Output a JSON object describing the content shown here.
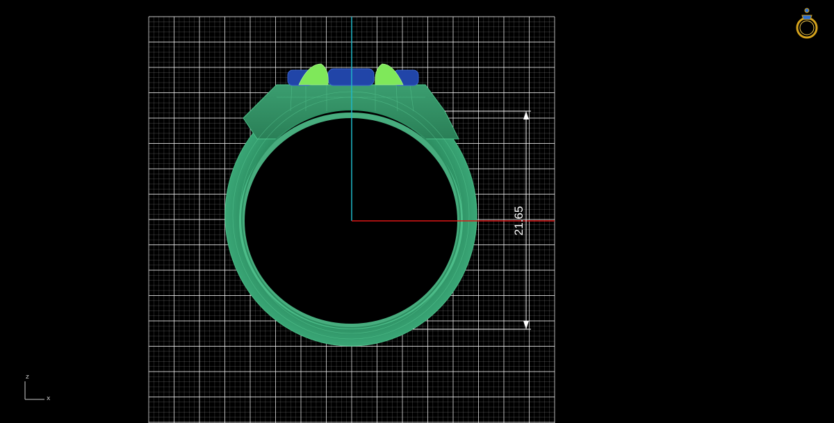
{
  "viewport": {
    "background": "#000000",
    "grid_color": "#ffffff",
    "view": "front"
  },
  "axes": {
    "vertical_axis_color": "#1fb7c8",
    "horizontal_axis_color": "#e01616"
  },
  "ring": {
    "band_color": "#2e8f62",
    "band_edge_color": "#4cc28a",
    "stone_color": "#2145a8",
    "prong_color": "#7fe85a"
  },
  "dimension": {
    "label": "21.65",
    "color": "#ffffff"
  },
  "axis_indicator": {
    "vertical_label": "z",
    "horizontal_label": "x"
  },
  "view_cube": {
    "icon": "ring-view-icon",
    "color": "#d4a21c"
  }
}
